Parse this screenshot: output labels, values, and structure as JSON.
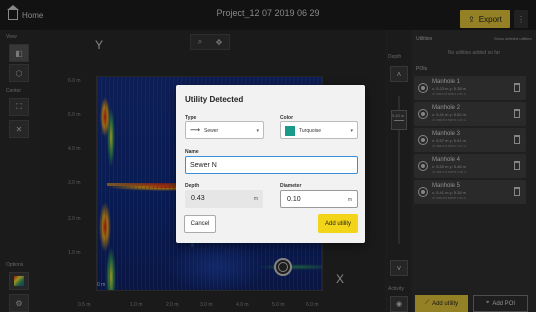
{
  "app": {
    "home_label": "Home",
    "project_title": "Project_12 07 2019 06 29",
    "export_label": "Export",
    "more_label": "⋮"
  },
  "left_toolbar": {
    "view_label": "View",
    "center_label": "Center",
    "options_label": "Options"
  },
  "plot": {
    "y_axis_label": "Y",
    "x_axis_label": "X",
    "y_ticks": [
      "6.0 m",
      "5.0 m",
      "4.0 m",
      "3.0 m",
      "2.0 m",
      "1.0 m"
    ],
    "x_ticks": [
      "0.5 m",
      "1.0 m",
      "2.0 m",
      "3.0 m",
      "4.0 m",
      "5.0 m",
      "6.0 m"
    ],
    "offset_label": "0 m",
    "zoom_icon": "zoom-icon",
    "pan_icon": "pan-icon"
  },
  "depth": {
    "label": "Depth",
    "slider_value": "0.43 m",
    "activity_label": "Activity"
  },
  "right_panel": {
    "utilities_title": "Utilities",
    "show_deleted_label": "Show deleted utilities",
    "empty_text": "No utilities added so far",
    "pois_title": "POIs",
    "pois": [
      {
        "name": "Manhole 1",
        "coords": "x: 5.23 m  y: 5.38 m",
        "sub": "47.36514 8.52871  2.35 m"
      },
      {
        "name": "Manhole 2",
        "coords": "x: 5.41 m  y: 5.52 m",
        "sub": "47.36515 8.52873  2.36 m"
      },
      {
        "name": "Manhole 3",
        "coords": "x: 5.57 m  y: 5.51 m",
        "sub": "47.36516 8.52874  2.37 m"
      },
      {
        "name": "Manhole 4",
        "coords": "x: 5.50 m  y: 5.46 m",
        "sub": "47.36517 8.52875  2.38 m"
      },
      {
        "name": "Manhole 5",
        "coords": "x: 5.41 m  y: 5.26 m",
        "sub": "47.36518 8.52876  2.39 m"
      }
    ],
    "add_utility_label": "Add utility",
    "add_poi_label": "Add POI"
  },
  "dialog": {
    "title": "Utility Detected",
    "type_label": "Type",
    "type_value": "Sewer",
    "color_label": "Color",
    "color_value": "Turquoise",
    "color_hex": "#1a9a8a",
    "name_label": "Name",
    "name_value": "Sewer N",
    "depth_label": "Depth",
    "depth_value": "0.43",
    "depth_unit": "m",
    "diameter_label": "Diameter",
    "diameter_value": "0.10",
    "diameter_unit": "m",
    "cancel_label": "Cancel",
    "add_label": "Add utility"
  },
  "colors": {
    "accent": "#e3c63a",
    "focus": "#3a8fd9",
    "background": "#2b2b2b"
  }
}
